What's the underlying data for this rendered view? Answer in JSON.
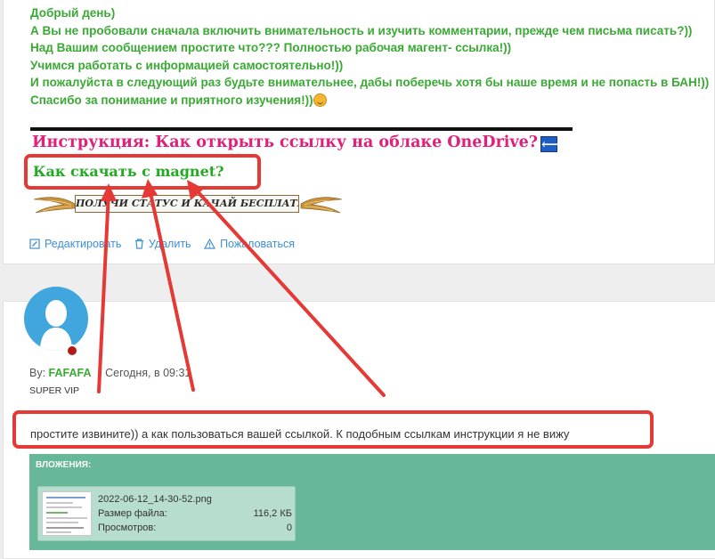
{
  "reply": {
    "lines": [
      "Добрый день)",
      "А Вы не пробовали сначала включить внимательность и изучить комментарии, прежде чем письма писать?))",
      "Над Вашим сообщением простите что??? Полностью рабочая магент- ссылка!))",
      "Учимся работать с информацией самостоятельно!))",
      "И пожалуйста в следующий раз будьте внимательнее, дабы поберечь хотя бы наше время и не попасть в БАН!))",
      "Спасибо за понимание и приятного изучения!))"
    ]
  },
  "signature": {
    "onedrive_link": "Инструкция: Как открыть ссылку на облаке OneDrive?",
    "arrow_glyph": "⟵",
    "magnet_link": "Как скачать с magnet?",
    "banner_text": "ПОЛУЧИ СТАТУС И КАЧАЙ БЕСПЛАТНО!"
  },
  "actions": {
    "edit": "Редактировать",
    "delete": "Удалить",
    "report": "Пожаловаться"
  },
  "post": {
    "by_label": "By:",
    "author": "FAFAFA",
    "dash": "-",
    "time": "Сегодня, в 09:31",
    "user_title": "SUPER VIP",
    "message": "простите извините)) а как пользоваться вашей ссылкой. К подобным ссылкам инструкции я не вижу"
  },
  "attachments": {
    "title": "ВЛОЖЕНИЯ:",
    "file": {
      "name": "2022-06-12_14-30-52.png",
      "size_label": "Размер файла:",
      "size_value": "116,2 КБ",
      "views_label": "Просмотров:",
      "views_value": "0"
    }
  },
  "colors": {
    "green_text": "#3aaa35",
    "pink_link": "#e0207a",
    "link_blue": "#3d8fd6",
    "annotation_red": "#e53935",
    "attachments_bg": "#67b898"
  }
}
